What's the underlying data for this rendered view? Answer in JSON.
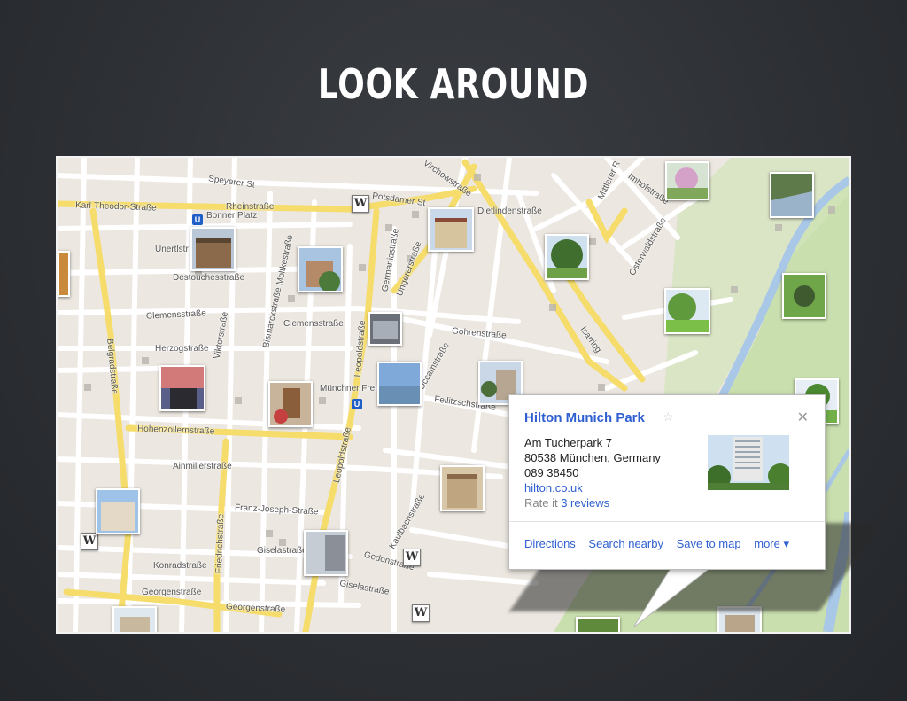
{
  "slide": {
    "title": "LOOK AROUND"
  },
  "map": {
    "streets": [
      {
        "id": "karl-theodor",
        "label": "Karl-Theodor-Straße"
      },
      {
        "id": "rheinstrasse",
        "label": "Rheinstraße"
      },
      {
        "id": "potsdamer",
        "label": "Potsdamer St"
      },
      {
        "id": "speyerer",
        "label": "Speyerer St"
      },
      {
        "id": "dietlinden",
        "label": "Dietlindenstraße"
      },
      {
        "id": "unertl",
        "label": "Unertlstr"
      },
      {
        "id": "destouches",
        "label": "Destouchesstraße"
      },
      {
        "id": "clemens1",
        "label": "Clemensstraße"
      },
      {
        "id": "clemens2",
        "label": "Clemensstraße"
      },
      {
        "id": "herzogstr",
        "label": "Herzogstraße"
      },
      {
        "id": "hohenzollern",
        "label": "Hohenzollernstraße"
      },
      {
        "id": "ainmiller",
        "label": "Ainmillerstraße"
      },
      {
        "id": "franz-joseph",
        "label": "Franz-Joseph-Straße"
      },
      {
        "id": "gisela1",
        "label": "Giselastraße"
      },
      {
        "id": "gisela2",
        "label": "Giselastraße"
      },
      {
        "id": "georgen1",
        "label": "Georgenstraße"
      },
      {
        "id": "georgen2",
        "label": "Georgenstraße"
      },
      {
        "id": "konrad",
        "label": "Konradstraße"
      },
      {
        "id": "gohren",
        "label": "Gohrenstraße"
      },
      {
        "id": "mittlerer",
        "label": "Mittlerer R"
      },
      {
        "id": "isarring",
        "label": "Isarring"
      },
      {
        "id": "ungerer",
        "label": "Ungererstraße"
      },
      {
        "id": "leopold1",
        "label": "Leopoldstraße"
      },
      {
        "id": "leopold2",
        "label": "Leopoldstraße"
      },
      {
        "id": "belgrad",
        "label": "Belgradstraße"
      },
      {
        "id": "friedrich",
        "label": "Friedrichstraße"
      },
      {
        "id": "muenchner-freiheit",
        "label": "Münchner Freiheit"
      },
      {
        "id": "bonner-platz",
        "label": "Bonner Platz"
      },
      {
        "id": "germania",
        "label": "Germaniastraße"
      },
      {
        "id": "osterwald",
        "label": "Osterwaldstraße"
      },
      {
        "id": "imhof",
        "label": "Imhofstraße"
      },
      {
        "id": "occam",
        "label": "Occamstraße"
      },
      {
        "id": "gedon",
        "label": "Gedonstraße"
      },
      {
        "id": "feilitzsch",
        "label": "Feilitzschstraße"
      },
      {
        "id": "viktor",
        "label": "Viktorstraße"
      },
      {
        "id": "bismarck",
        "label": "Bismarckstraße"
      },
      {
        "id": "moltke",
        "label": "Moltkestraße"
      },
      {
        "id": "kaulbach",
        "label": "Kaulbachstraße"
      },
      {
        "id": "virchow",
        "label": "Virchowstraße"
      }
    ]
  },
  "info_window": {
    "name": "Hilton Munich Park",
    "star": "☆",
    "close": "✕",
    "address_line1": "Am Tucherpark 7",
    "address_line2": "80538 München, Germany",
    "phone": "089 38450",
    "website": "hilton.co.uk",
    "rate_prefix": "Rate it",
    "reviews": "3 reviews",
    "actions": {
      "directions": "Directions",
      "search_nearby": "Search nearby",
      "save_to_map": "Save to map",
      "more": "more ▾"
    }
  },
  "badges": {
    "wikipedia": "W",
    "ubahn": "U"
  },
  "icons": {
    "close": "close-icon",
    "star": "star-icon",
    "wikipedia": "wikipedia-icon",
    "ubahn": "ubahn-icon",
    "photo": "photo-icon"
  },
  "colors": {
    "map_bg": "#ece7e0",
    "major_road": "#f5dc6b",
    "minor_road": "#ffffff",
    "park": "#c9dfae",
    "water": "#a9c7e6",
    "link": "#2f5fd0"
  }
}
